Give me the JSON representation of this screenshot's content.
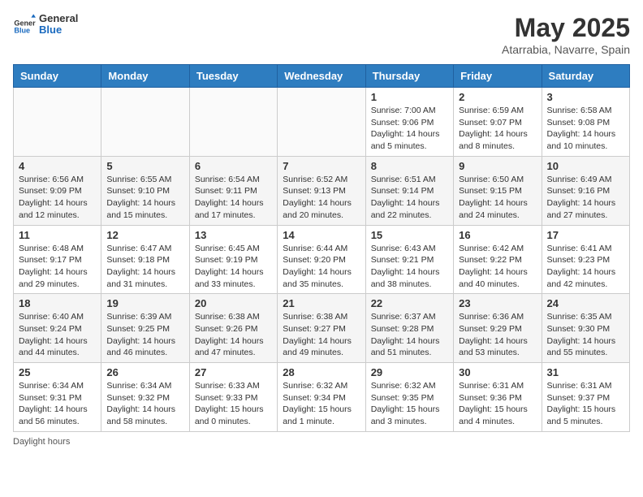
{
  "header": {
    "logo_general": "General",
    "logo_blue": "Blue",
    "month_title": "May 2025",
    "location": "Atarrabia, Navarre, Spain"
  },
  "days_of_week": [
    "Sunday",
    "Monday",
    "Tuesday",
    "Wednesday",
    "Thursday",
    "Friday",
    "Saturday"
  ],
  "weeks": [
    [
      {
        "day": "",
        "info": ""
      },
      {
        "day": "",
        "info": ""
      },
      {
        "day": "",
        "info": ""
      },
      {
        "day": "",
        "info": ""
      },
      {
        "day": "1",
        "info": "Sunrise: 7:00 AM\nSunset: 9:06 PM\nDaylight: 14 hours\nand 5 minutes."
      },
      {
        "day": "2",
        "info": "Sunrise: 6:59 AM\nSunset: 9:07 PM\nDaylight: 14 hours\nand 8 minutes."
      },
      {
        "day": "3",
        "info": "Sunrise: 6:58 AM\nSunset: 9:08 PM\nDaylight: 14 hours\nand 10 minutes."
      }
    ],
    [
      {
        "day": "4",
        "info": "Sunrise: 6:56 AM\nSunset: 9:09 PM\nDaylight: 14 hours\nand 12 minutes."
      },
      {
        "day": "5",
        "info": "Sunrise: 6:55 AM\nSunset: 9:10 PM\nDaylight: 14 hours\nand 15 minutes."
      },
      {
        "day": "6",
        "info": "Sunrise: 6:54 AM\nSunset: 9:11 PM\nDaylight: 14 hours\nand 17 minutes."
      },
      {
        "day": "7",
        "info": "Sunrise: 6:52 AM\nSunset: 9:13 PM\nDaylight: 14 hours\nand 20 minutes."
      },
      {
        "day": "8",
        "info": "Sunrise: 6:51 AM\nSunset: 9:14 PM\nDaylight: 14 hours\nand 22 minutes."
      },
      {
        "day": "9",
        "info": "Sunrise: 6:50 AM\nSunset: 9:15 PM\nDaylight: 14 hours\nand 24 minutes."
      },
      {
        "day": "10",
        "info": "Sunrise: 6:49 AM\nSunset: 9:16 PM\nDaylight: 14 hours\nand 27 minutes."
      }
    ],
    [
      {
        "day": "11",
        "info": "Sunrise: 6:48 AM\nSunset: 9:17 PM\nDaylight: 14 hours\nand 29 minutes."
      },
      {
        "day": "12",
        "info": "Sunrise: 6:47 AM\nSunset: 9:18 PM\nDaylight: 14 hours\nand 31 minutes."
      },
      {
        "day": "13",
        "info": "Sunrise: 6:45 AM\nSunset: 9:19 PM\nDaylight: 14 hours\nand 33 minutes."
      },
      {
        "day": "14",
        "info": "Sunrise: 6:44 AM\nSunset: 9:20 PM\nDaylight: 14 hours\nand 35 minutes."
      },
      {
        "day": "15",
        "info": "Sunrise: 6:43 AM\nSunset: 9:21 PM\nDaylight: 14 hours\nand 38 minutes."
      },
      {
        "day": "16",
        "info": "Sunrise: 6:42 AM\nSunset: 9:22 PM\nDaylight: 14 hours\nand 40 minutes."
      },
      {
        "day": "17",
        "info": "Sunrise: 6:41 AM\nSunset: 9:23 PM\nDaylight: 14 hours\nand 42 minutes."
      }
    ],
    [
      {
        "day": "18",
        "info": "Sunrise: 6:40 AM\nSunset: 9:24 PM\nDaylight: 14 hours\nand 44 minutes."
      },
      {
        "day": "19",
        "info": "Sunrise: 6:39 AM\nSunset: 9:25 PM\nDaylight: 14 hours\nand 46 minutes."
      },
      {
        "day": "20",
        "info": "Sunrise: 6:38 AM\nSunset: 9:26 PM\nDaylight: 14 hours\nand 47 minutes."
      },
      {
        "day": "21",
        "info": "Sunrise: 6:38 AM\nSunset: 9:27 PM\nDaylight: 14 hours\nand 49 minutes."
      },
      {
        "day": "22",
        "info": "Sunrise: 6:37 AM\nSunset: 9:28 PM\nDaylight: 14 hours\nand 51 minutes."
      },
      {
        "day": "23",
        "info": "Sunrise: 6:36 AM\nSunset: 9:29 PM\nDaylight: 14 hours\nand 53 minutes."
      },
      {
        "day": "24",
        "info": "Sunrise: 6:35 AM\nSunset: 9:30 PM\nDaylight: 14 hours\nand 55 minutes."
      }
    ],
    [
      {
        "day": "25",
        "info": "Sunrise: 6:34 AM\nSunset: 9:31 PM\nDaylight: 14 hours\nand 56 minutes."
      },
      {
        "day": "26",
        "info": "Sunrise: 6:34 AM\nSunset: 9:32 PM\nDaylight: 14 hours\nand 58 minutes."
      },
      {
        "day": "27",
        "info": "Sunrise: 6:33 AM\nSunset: 9:33 PM\nDaylight: 15 hours\nand 0 minutes."
      },
      {
        "day": "28",
        "info": "Sunrise: 6:32 AM\nSunset: 9:34 PM\nDaylight: 15 hours\nand 1 minute."
      },
      {
        "day": "29",
        "info": "Sunrise: 6:32 AM\nSunset: 9:35 PM\nDaylight: 15 hours\nand 3 minutes."
      },
      {
        "day": "30",
        "info": "Sunrise: 6:31 AM\nSunset: 9:36 PM\nDaylight: 15 hours\nand 4 minutes."
      },
      {
        "day": "31",
        "info": "Sunrise: 6:31 AM\nSunset: 9:37 PM\nDaylight: 15 hours\nand 5 minutes."
      }
    ]
  ],
  "footer": {
    "note": "Daylight hours"
  }
}
